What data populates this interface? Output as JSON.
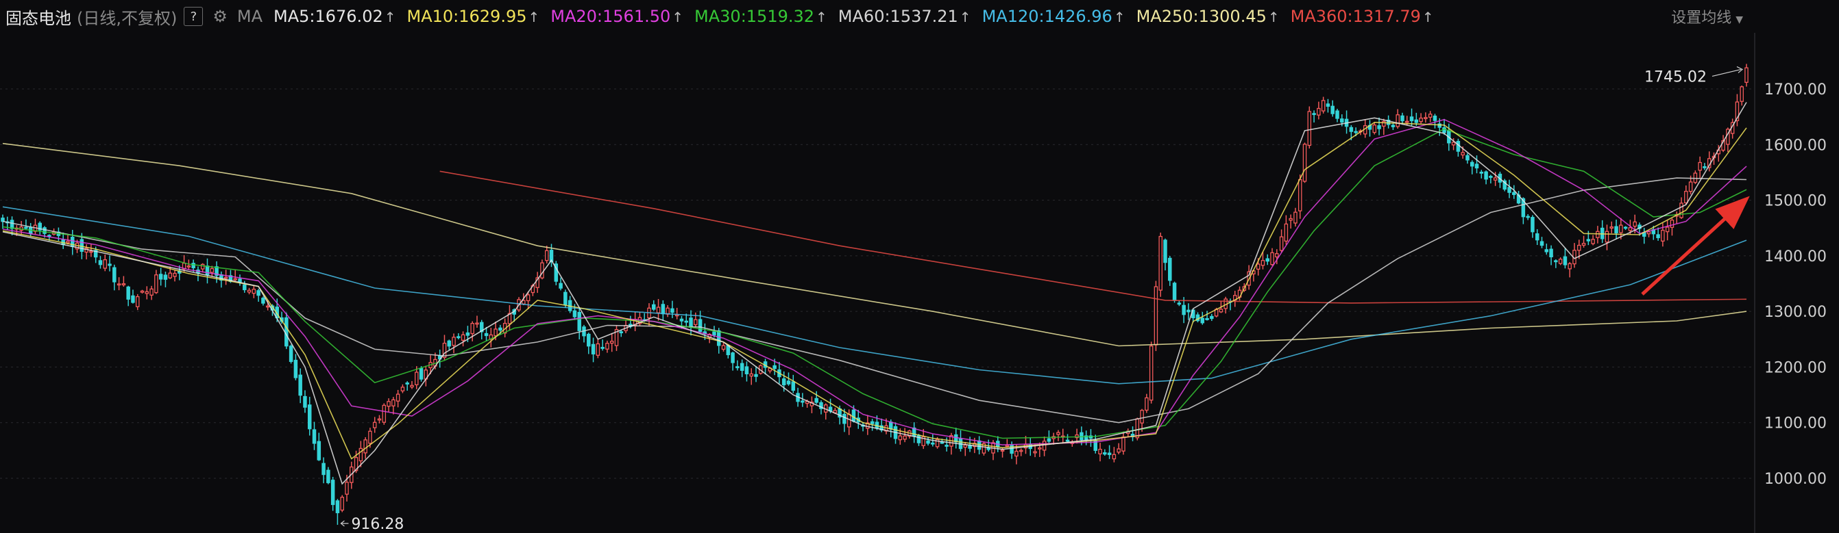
{
  "header": {
    "title": "固态电池",
    "subtitle": "(日线,不复权)",
    "help_icon": "question-mark-icon",
    "settings_icon": "gear-icon",
    "ma_label": "MA",
    "ma_items": [
      {
        "label": "MA5:1676.02",
        "color": "#e6e6e6"
      },
      {
        "label": "MA10:1629.95",
        "color": "#f1e35a"
      },
      {
        "label": "MA20:1561.50",
        "color": "#e040e0"
      },
      {
        "label": "MA30:1519.32",
        "color": "#36c936"
      },
      {
        "label": "MA60:1537.21",
        "color": "#d6d6d6"
      },
      {
        "label": "MA120:1426.96",
        "color": "#46bde8"
      },
      {
        "label": "MA250:1300.45",
        "color": "#efe7a0"
      },
      {
        "label": "MA360:1317.79",
        "color": "#ea4b45"
      }
    ],
    "arrow_glyph": "↑",
    "settings_label": "设置均线"
  },
  "colors": {
    "up": "#f25a5a",
    "down": "#35d4d8",
    "grid": "#2a2a2e",
    "axis_text": "#d0d0d0",
    "annotation_arrow": "#e8332c",
    "background": "#0b0b0d"
  },
  "chart_data": {
    "type": "candlestick",
    "title": "固态电池",
    "y_ticks": [
      "1000.00",
      "1100.00",
      "1200.00",
      "1300.00",
      "1400.00",
      "1500.00",
      "1600.00",
      "1700.00"
    ],
    "ylim": [
      910,
      1790
    ],
    "high_label": "1745.02",
    "low_label": "916.28",
    "grid": true,
    "annotation": "red arrow pointing up-right toward latest rising MA lines",
    "waypoints": [
      [
        0,
        1462
      ],
      [
        10,
        1440
      ],
      [
        20,
        1405
      ],
      [
        28,
        1318
      ],
      [
        33,
        1355
      ],
      [
        40,
        1385
      ],
      [
        47,
        1362
      ],
      [
        55,
        1338
      ],
      [
        60,
        1272
      ],
      [
        66,
        1090
      ],
      [
        72,
        935
      ],
      [
        75,
        1010
      ],
      [
        82,
        1135
      ],
      [
        88,
        1172
      ],
      [
        95,
        1232
      ],
      [
        101,
        1272
      ],
      [
        107,
        1262
      ],
      [
        113,
        1340
      ],
      [
        117,
        1402
      ],
      [
        121,
        1322
      ],
      [
        127,
        1228
      ],
      [
        133,
        1272
      ],
      [
        140,
        1305
      ],
      [
        146,
        1288
      ],
      [
        153,
        1262
      ],
      [
        159,
        1185
      ],
      [
        165,
        1198
      ],
      [
        171,
        1140
      ],
      [
        178,
        1118
      ],
      [
        184,
        1098
      ],
      [
        190,
        1086
      ],
      [
        196,
        1072
      ],
      [
        203,
        1068
      ],
      [
        210,
        1058
      ],
      [
        216,
        1052
      ],
      [
        221,
        1052
      ],
      [
        227,
        1082
      ],
      [
        233,
        1068
      ],
      [
        238,
        1045
      ],
      [
        243,
        1085
      ],
      [
        246,
        1148
      ],
      [
        249,
        1435
      ],
      [
        252,
        1312
      ],
      [
        256,
        1282
      ],
      [
        262,
        1302
      ],
      [
        268,
        1362
      ],
      [
        274,
        1412
      ],
      [
        278,
        1482
      ],
      [
        281,
        1658
      ],
      [
        284,
        1672
      ],
      [
        288,
        1638
      ],
      [
        294,
        1622
      ],
      [
        300,
        1645
      ],
      [
        306,
        1652
      ],
      [
        312,
        1605
      ],
      [
        318,
        1548
      ],
      [
        324,
        1525
      ],
      [
        329,
        1452
      ],
      [
        334,
        1380
      ],
      [
        339,
        1408
      ],
      [
        345,
        1448
      ],
      [
        350,
        1455
      ],
      [
        355,
        1435
      ],
      [
        359,
        1468
      ],
      [
        364,
        1548
      ],
      [
        369,
        1598
      ],
      [
        372,
        1648
      ],
      [
        375,
        1745
      ]
    ],
    "ma_lines": [
      {
        "name": "MA250",
        "color": "#efe7a0",
        "points": [
          [
            0,
            1602
          ],
          [
            38,
            1562
          ],
          [
            75,
            1512
          ],
          [
            115,
            1418
          ],
          [
            160,
            1355
          ],
          [
            200,
            1300
          ],
          [
            240,
            1238
          ],
          [
            280,
            1250
          ],
          [
            320,
            1270
          ],
          [
            360,
            1283
          ],
          [
            375,
            1300
          ]
        ]
      },
      {
        "name": "MA360",
        "color": "#ea4b45",
        "points": [
          [
            94,
            1552
          ],
          [
            140,
            1485
          ],
          [
            180,
            1418
          ],
          [
            220,
            1362
          ],
          [
            250,
            1320
          ],
          [
            290,
            1315
          ],
          [
            330,
            1318
          ],
          [
            375,
            1322
          ]
        ]
      },
      {
        "name": "MA120",
        "color": "#46bde8",
        "points": [
          [
            0,
            1488
          ],
          [
            40,
            1435
          ],
          [
            80,
            1342
          ],
          [
            115,
            1310
          ],
          [
            150,
            1292
          ],
          [
            180,
            1235
          ],
          [
            210,
            1195
          ],
          [
            240,
            1170
          ],
          [
            260,
            1180
          ],
          [
            290,
            1250
          ],
          [
            320,
            1292
          ],
          [
            350,
            1348
          ],
          [
            375,
            1428
          ]
        ]
      },
      {
        "name": "MA60",
        "color": "#d6d6d6",
        "points": [
          [
            0,
            1462
          ],
          [
            30,
            1412
          ],
          [
            50,
            1398
          ],
          [
            65,
            1288
          ],
          [
            80,
            1232
          ],
          [
            95,
            1220
          ],
          [
            115,
            1245
          ],
          [
            130,
            1275
          ],
          [
            150,
            1272
          ],
          [
            180,
            1212
          ],
          [
            210,
            1140
          ],
          [
            240,
            1100
          ],
          [
            255,
            1125
          ],
          [
            270,
            1188
          ],
          [
            285,
            1315
          ],
          [
            300,
            1395
          ],
          [
            320,
            1478
          ],
          [
            340,
            1518
          ],
          [
            360,
            1540
          ],
          [
            375,
            1537
          ]
        ]
      },
      {
        "name": "MA30",
        "color": "#36c936",
        "points": [
          [
            0,
            1452
          ],
          [
            20,
            1432
          ],
          [
            40,
            1385
          ],
          [
            55,
            1370
          ],
          [
            65,
            1282
          ],
          [
            80,
            1172
          ],
          [
            95,
            1212
          ],
          [
            110,
            1270
          ],
          [
            125,
            1288
          ],
          [
            140,
            1282
          ],
          [
            155,
            1262
          ],
          [
            170,
            1225
          ],
          [
            185,
            1152
          ],
          [
            200,
            1098
          ],
          [
            215,
            1072
          ],
          [
            235,
            1075
          ],
          [
            250,
            1095
          ],
          [
            262,
            1210
          ],
          [
            272,
            1335
          ],
          [
            282,
            1445
          ],
          [
            295,
            1562
          ],
          [
            310,
            1628
          ],
          [
            325,
            1582
          ],
          [
            340,
            1552
          ],
          [
            355,
            1470
          ],
          [
            365,
            1478
          ],
          [
            375,
            1519
          ]
        ]
      },
      {
        "name": "MA20",
        "color": "#e040e0",
        "points": [
          [
            0,
            1448
          ],
          [
            20,
            1420
          ],
          [
            40,
            1375
          ],
          [
            55,
            1355
          ],
          [
            65,
            1255
          ],
          [
            75,
            1130
          ],
          [
            88,
            1112
          ],
          [
            100,
            1175
          ],
          [
            115,
            1278
          ],
          [
            128,
            1292
          ],
          [
            140,
            1282
          ],
          [
            155,
            1252
          ],
          [
            170,
            1195
          ],
          [
            185,
            1115
          ],
          [
            200,
            1080
          ],
          [
            215,
            1060
          ],
          [
            235,
            1065
          ],
          [
            248,
            1082
          ],
          [
            256,
            1185
          ],
          [
            266,
            1290
          ],
          [
            280,
            1470
          ],
          [
            295,
            1610
          ],
          [
            310,
            1645
          ],
          [
            325,
            1588
          ],
          [
            340,
            1518
          ],
          [
            352,
            1440
          ],
          [
            362,
            1462
          ],
          [
            375,
            1561
          ]
        ]
      },
      {
        "name": "MA10",
        "color": "#f1e35a",
        "points": [
          [
            0,
            1445
          ],
          [
            20,
            1412
          ],
          [
            40,
            1368
          ],
          [
            55,
            1345
          ],
          [
            65,
            1222
          ],
          [
            75,
            1035
          ],
          [
            85,
            1098
          ],
          [
            100,
            1210
          ],
          [
            115,
            1320
          ],
          [
            125,
            1305
          ],
          [
            140,
            1275
          ],
          [
            155,
            1245
          ],
          [
            170,
            1175
          ],
          [
            185,
            1100
          ],
          [
            200,
            1072
          ],
          [
            215,
            1055
          ],
          [
            235,
            1068
          ],
          [
            248,
            1080
          ],
          [
            256,
            1282
          ],
          [
            266,
            1325
          ],
          [
            280,
            1555
          ],
          [
            295,
            1640
          ],
          [
            310,
            1635
          ],
          [
            325,
            1545
          ],
          [
            340,
            1440
          ],
          [
            352,
            1438
          ],
          [
            362,
            1482
          ],
          [
            375,
            1630
          ]
        ]
      },
      {
        "name": "MA5",
        "color": "#e6e6e6",
        "points": [
          [
            0,
            1443
          ],
          [
            20,
            1408
          ],
          [
            40,
            1372
          ],
          [
            55,
            1345
          ],
          [
            65,
            1200
          ],
          [
            73,
            990
          ],
          [
            80,
            1050
          ],
          [
            95,
            1225
          ],
          [
            110,
            1300
          ],
          [
            118,
            1392
          ],
          [
            128,
            1250
          ],
          [
            140,
            1290
          ],
          [
            155,
            1245
          ],
          [
            170,
            1150
          ],
          [
            185,
            1095
          ],
          [
            200,
            1068
          ],
          [
            215,
            1052
          ],
          [
            235,
            1070
          ],
          [
            248,
            1095
          ],
          [
            256,
            1305
          ],
          [
            268,
            1365
          ],
          [
            280,
            1625
          ],
          [
            295,
            1648
          ],
          [
            310,
            1620
          ],
          [
            325,
            1518
          ],
          [
            338,
            1395
          ],
          [
            352,
            1450
          ],
          [
            362,
            1492
          ],
          [
            375,
            1676
          ]
        ]
      }
    ]
  }
}
